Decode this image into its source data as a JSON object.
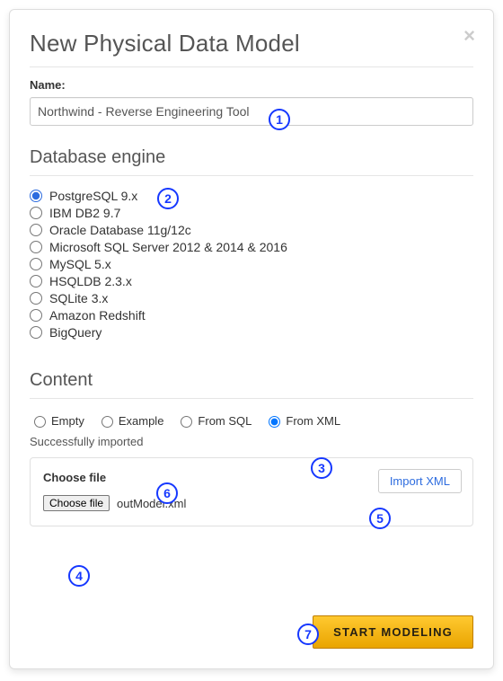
{
  "dialog": {
    "title": "New Physical Data Model",
    "name_label": "Name:",
    "name_value": "Northwind - Reverse Engineering Tool"
  },
  "engine": {
    "section_title": "Database engine",
    "selected": "PostgreSQL 9.x",
    "options": [
      "PostgreSQL 9.x",
      "IBM DB2 9.7",
      "Oracle Database 11g/12c",
      "Microsoft SQL Server 2012 & 2014 & 2016",
      "MySQL 5.x",
      "HSQLDB 2.3.x",
      "SQLite 3.x",
      "Amazon Redshift",
      "BigQuery"
    ]
  },
  "content": {
    "section_title": "Content",
    "options": [
      "Empty",
      "Example",
      "From SQL",
      "From XML"
    ],
    "selected": "From XML",
    "status": "Successfully imported",
    "choose_file_label": "Choose file",
    "choose_file_button": "Choose file",
    "file_name": "outModel.xml",
    "import_button": "Import XML"
  },
  "footer": {
    "start_button": "START MODELING"
  },
  "annotations": [
    "1",
    "2",
    "3",
    "4",
    "5",
    "6",
    "7"
  ]
}
